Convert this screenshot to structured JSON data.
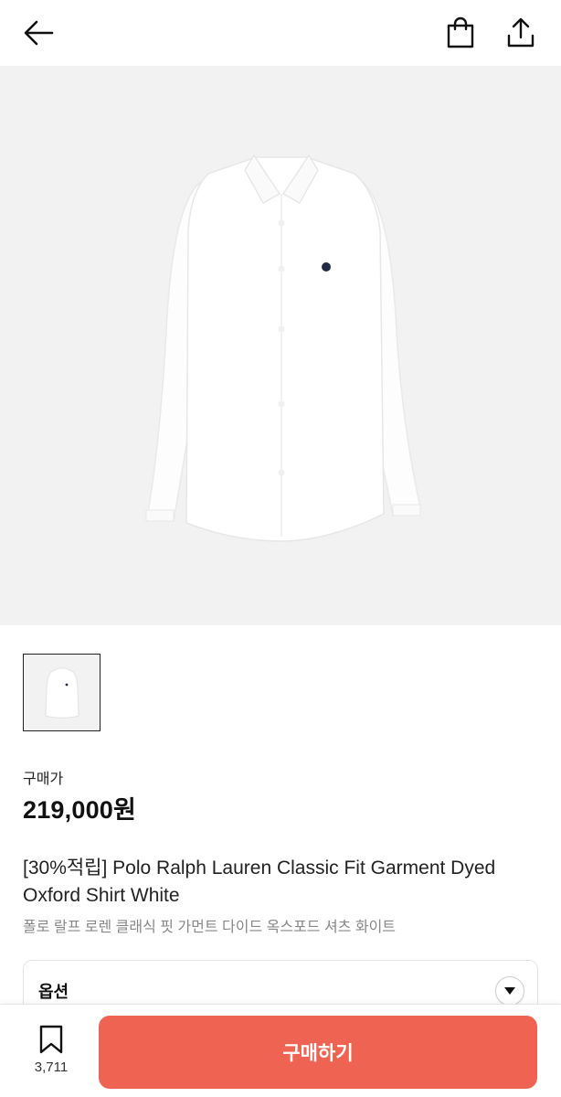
{
  "header": {
    "back_icon": "arrow-left-icon",
    "bag_icon": "shopping-bag-icon",
    "share_icon": "share-icon"
  },
  "product": {
    "image": "white oxford shirt with navy logo",
    "price_label": "구매가",
    "price": "219,000원",
    "title": "[30%적립] Polo Ralph Lauren Classic Fit Garment Dyed Oxford Shirt White",
    "subtitle": "폴로 랄프 로렌 클래식 핏 가먼트 다이드 옥스포드 셔츠 화이트"
  },
  "option": {
    "label": "옵션",
    "icon": "chevron-down-icon"
  },
  "bottom": {
    "bookmark_icon": "bookmark-icon",
    "save_count": "3,711",
    "buy_label": "구매하기"
  },
  "colors": {
    "accent": "#ef6352",
    "image_bg": "#f2f2f2"
  }
}
